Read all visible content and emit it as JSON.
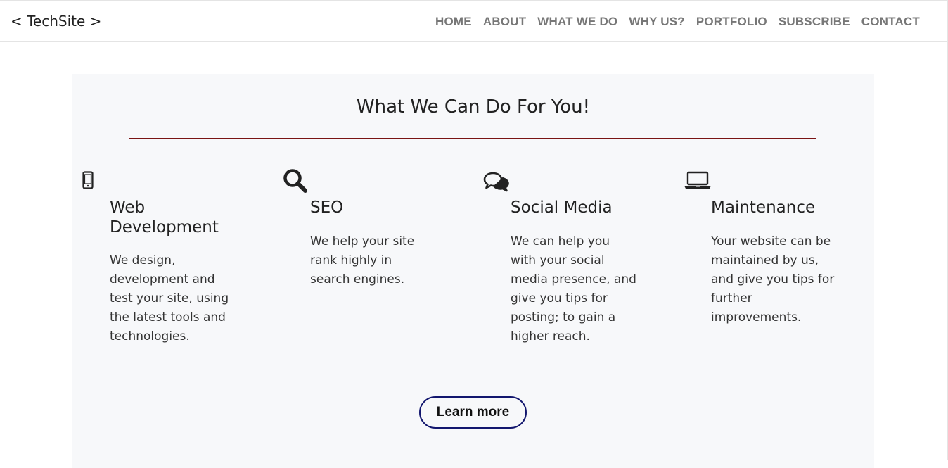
{
  "header": {
    "brand": "< TechSite >",
    "nav": [
      {
        "label": "HOME"
      },
      {
        "label": "ABOUT"
      },
      {
        "label": "WHAT WE DO"
      },
      {
        "label": "WHY US?"
      },
      {
        "label": "PORTFOLIO"
      },
      {
        "label": "SUBSCRIBE"
      },
      {
        "label": "CONTACT"
      }
    ]
  },
  "section": {
    "title": "What We Can Do For You!",
    "accent_color": "#7a1414",
    "services": [
      {
        "icon": "mobile-phone-icon",
        "title": "Web Development",
        "description": "We design, development and test your site, using the latest tools and technologies."
      },
      {
        "icon": "search-icon",
        "title": "SEO",
        "description": "We help your site rank highly in search engines."
      },
      {
        "icon": "chat-bubbles-icon",
        "title": "Social Media",
        "description": "We can help you with your social media presence, and give you tips for posting; to gain a higher reach."
      },
      {
        "icon": "laptop-icon",
        "title": "Maintenance",
        "description": "Your website can be maintained by us, and give you tips for further improvements."
      }
    ],
    "cta_label": "Learn more",
    "cta_border_color": "#12166e"
  }
}
